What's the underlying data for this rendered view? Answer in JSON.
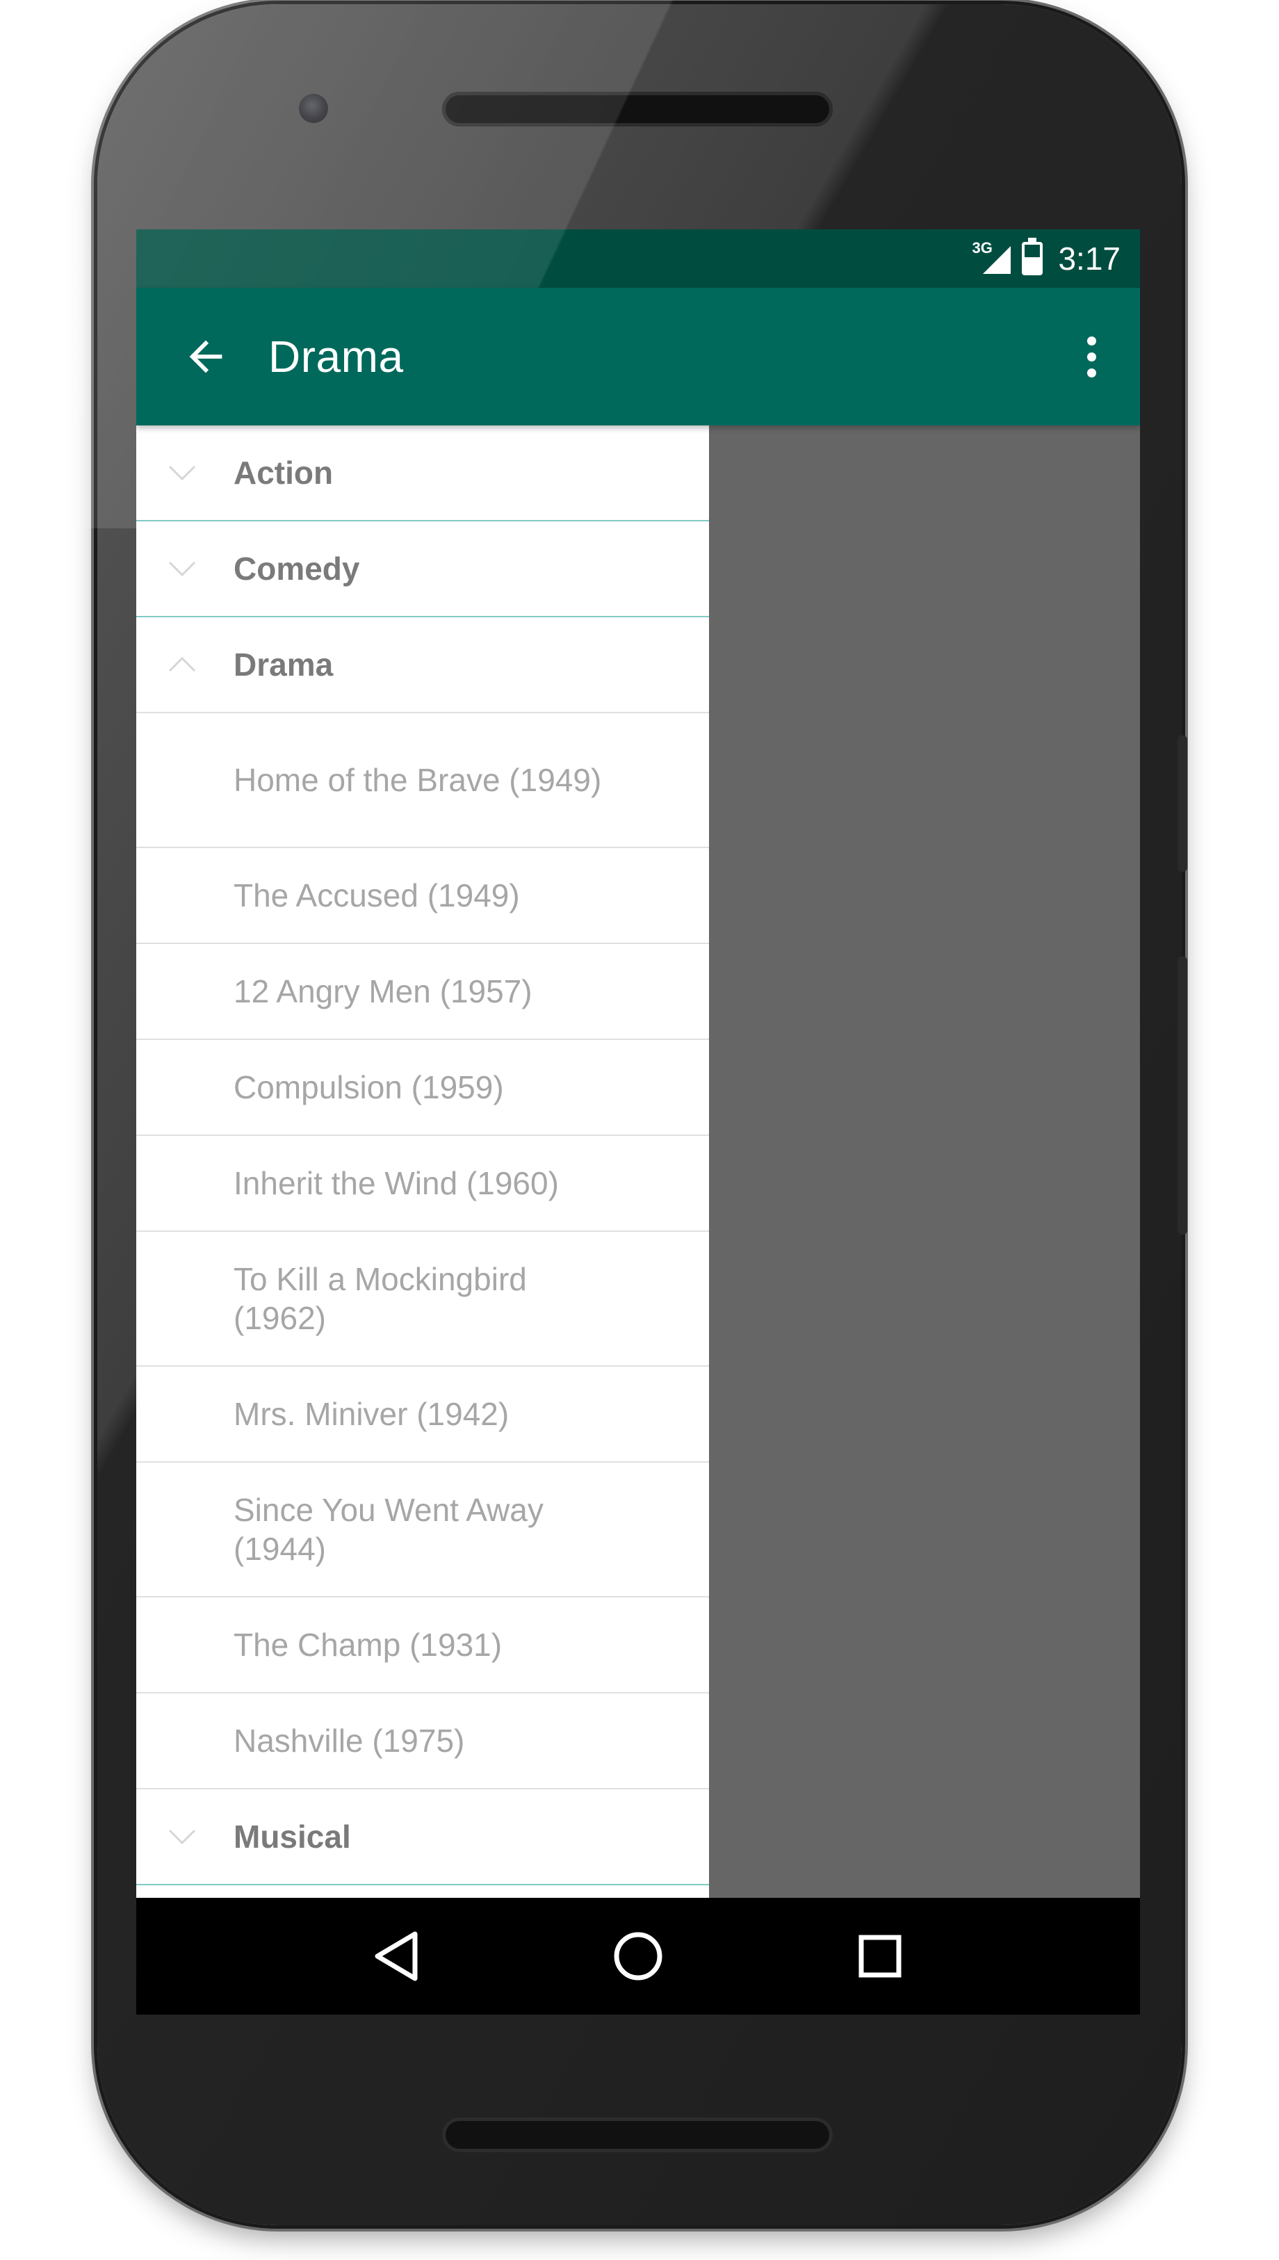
{
  "status_bar": {
    "network_label": "3G",
    "clock": "3:17",
    "icons": [
      "signal-icon",
      "battery-icon"
    ]
  },
  "app_bar": {
    "title": "Drama",
    "back_icon": "arrow-back-icon",
    "overflow_icon": "more-vert-icon",
    "color": "#00695c"
  },
  "list": {
    "groups": [
      {
        "label": "Action",
        "expanded": false
      },
      {
        "label": "Comedy",
        "expanded": false
      },
      {
        "label": "Drama",
        "expanded": true,
        "children": [
          "Home of the Brave (1949)",
          "The Accused (1949)",
          "12 Angry Men (1957)",
          "Compulsion (1959)",
          "Inherit the Wind (1960)",
          "To Kill a Mockingbird (1962)",
          "Mrs. Miniver (1942)",
          "Since You Went Away (1944)",
          "The Champ (1931)",
          "Nashville (1975)"
        ]
      },
      {
        "label": "Musical",
        "expanded": false
      }
    ]
  },
  "nav_bar": {
    "buttons": [
      "back-triangle-icon",
      "home-circle-icon",
      "recents-square-icon"
    ]
  },
  "colors": {
    "status_bar": "#004d40",
    "app_bar": "#00695c",
    "scrim": "#666666",
    "divider_accent": "#80cbc4"
  }
}
